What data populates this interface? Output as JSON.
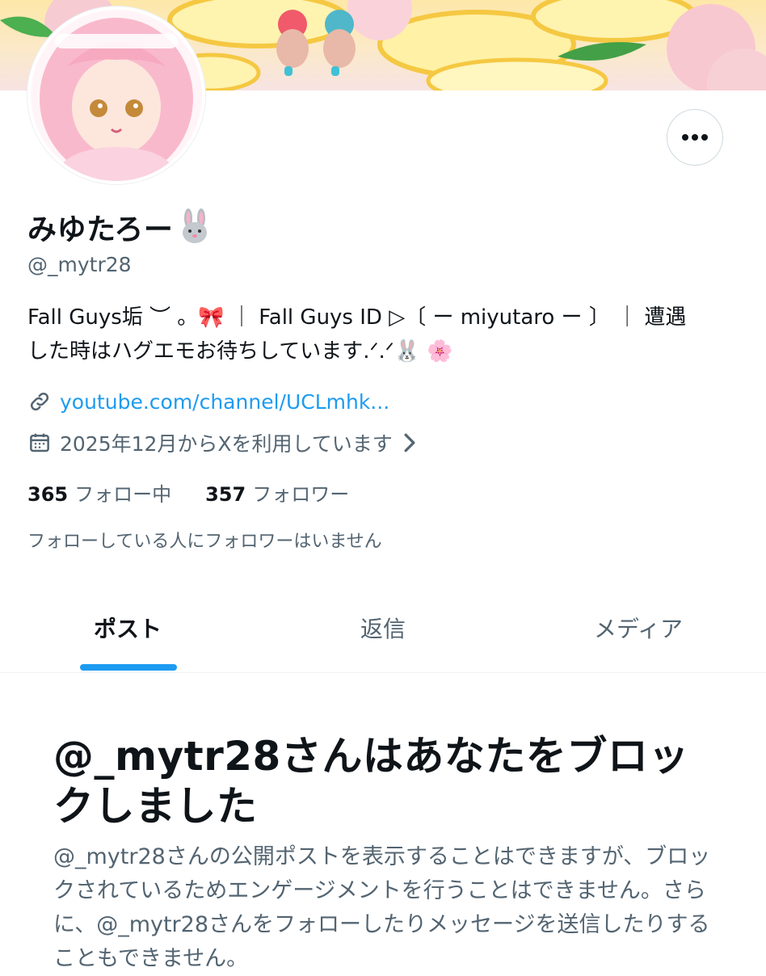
{
  "profile": {
    "display_name": "みゆたろー",
    "name_emoji": "rabbit-face-emoji",
    "handle": "@_mytr28",
    "bio_line1": "Fall Guys垢 ︶ 。🎀 ｜ Fall Guys ID ▷〔 ー miyutaro ー 〕 ｜ 遭遇",
    "bio_line2": "した時はハグエモお待ちしています.ᐟ.ᐟ🐰 🌸",
    "link": "youtube.com/channel/UCLmhk...",
    "joined": "2025年12月からXを利用しています",
    "following_count": "365",
    "following_label": "フォロー中",
    "followers_count": "357",
    "followers_label": "フォロワー",
    "followed_by": "フォローしている人にフォロワーはいません"
  },
  "icons": {
    "more": "more-horizontal-icon",
    "link": "link-icon",
    "calendar": "calendar-icon",
    "chevron": "chevron-right-icon"
  },
  "tabs": [
    {
      "label": "ポスト",
      "active": true
    },
    {
      "label": "返信",
      "active": false
    },
    {
      "label": "メディア",
      "active": false
    }
  ],
  "blocked": {
    "title": "@_mytr28さんはあなたをブロックしました",
    "description": "@_mytr28さんの公開ポストを表示することはできますが、ブロックされているためエンゲージメントを行うことはできません。さらに、@_mytr28さんをフォローしたりメッセージを送信したりすることもできません。"
  },
  "colors": {
    "accent": "#1d9bf0",
    "text": "#0f1419",
    "secondary": "#536471"
  }
}
